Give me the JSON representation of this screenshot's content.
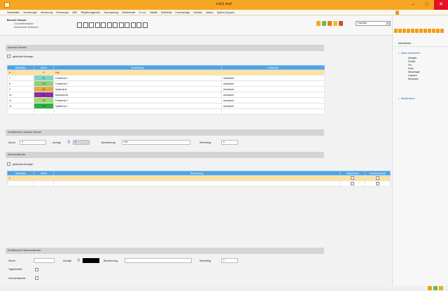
{
  "window": {
    "title": "ivis|3 xkaf"
  },
  "menu": {
    "items": [
      "Stammdaten",
      "Verordnungen",
      "Abrechnung",
      "Rechnungen",
      "MDE",
      "Pflegemanagement",
      "Tourenplanung",
      "Zeitwirtschaft",
      "Dienste",
      "Statistik",
      "Multimedia",
      "Druckmanager",
      "Kalender",
      "System",
      "System (Support)"
    ],
    "active_index": 8
  },
  "header": {
    "bereich_label": "Bereich: Dienste",
    "line2": "Grunddienstdaten",
    "line3": "Dienstraster definieren",
    "favorites_label": "Favoriten"
  },
  "side_panel": {
    "title": "Menüleiste",
    "group1": "Daten bearbeiten",
    "items": [
      "Anlegen",
      "Zurück",
      "Vor",
      "Ende",
      "Neuanlage",
      "Löschen",
      "Speichern"
    ],
    "group2": "Reaktivieren"
  },
  "normal": {
    "section_title": "Normale Dienste",
    "show_deleted_label": "gelöschte Anzeigen",
    "columns": [
      "Mitarbeiter",
      "Kürzel",
      "Bezeichnung",
      "Ort/Art/Zeit"
    ],
    "rows": [
      {
        "nr": "6",
        "kz": "X",
        "bez": "Frei",
        "info": "",
        "color": "#ffffff"
      },
      {
        "nr": "7",
        "kz": "F1",
        "bez": "Frühdienst 1",
        "info": "Arbeitszeit",
        "color": "#7fd6c7"
      },
      {
        "nr": "8",
        "kz": "F2",
        "bez": "Frühdienst 2",
        "info": "Arbeitszeit",
        "color": "#8fd07a"
      },
      {
        "nr": "9",
        "kz": "S1",
        "bez": "Spätschicht",
        "info": "Arbeitszeit",
        "color": "#e0ac4a"
      },
      {
        "nr": "10",
        "kz": "N1",
        "bez": "Nachtschicht",
        "info": "Arbeitszeit",
        "color": "#8e2aa8"
      },
      {
        "nr": "11",
        "kz": "F3",
        "bez": "Frühdienst 3",
        "info": "Arbeitszeit",
        "color": "#a4d86a"
      },
      {
        "nr": "12",
        "kz": "S2",
        "bez": "Spätdienst 2",
        "info": "Arbeitszeit",
        "color": "#2aae4a"
      }
    ]
  },
  "detail_normal": {
    "title": "Detailbereich normale Dienste",
    "kuerzel_label": "Kürzel",
    "kuerzel_value": "X",
    "anzeige_label": "Anzeige",
    "anzeige_value": "X",
    "bez_label": "Bezeichnung",
    "bez_value": "Frei",
    "reihenf_label": "Reihenfolg",
    "reihenf_value": "6"
  },
  "wechsel": {
    "section_title": "Wechseldienste",
    "show_deleted_label": "gelöschte Anzeigen",
    "columns": [
      "Mitarbeiter",
      "Kürzel",
      "Bezeichnung",
      "Tagesfortlauf",
      "Kommentarzeile"
    ],
    "rows": [
      {
        "nr": "1",
        "kz": "",
        "bez": ""
      }
    ]
  },
  "detail_wechsel": {
    "title": "Detailbereich Wechseldienste",
    "kuerzel_label": "Kürzel",
    "anzeige_label": "Anzeige",
    "bez_label": "Bezeichnung",
    "reihenf_label": "Reihenfolg",
    "reihenf_value": "1",
    "tagesfort_label": "Tagesfortlauf",
    "kommentar_label": "Kommentarzeile"
  },
  "colors": {
    "accent": "#f6a623",
    "table_header": "#4da3e8",
    "selected_row": "#fde2a2"
  }
}
